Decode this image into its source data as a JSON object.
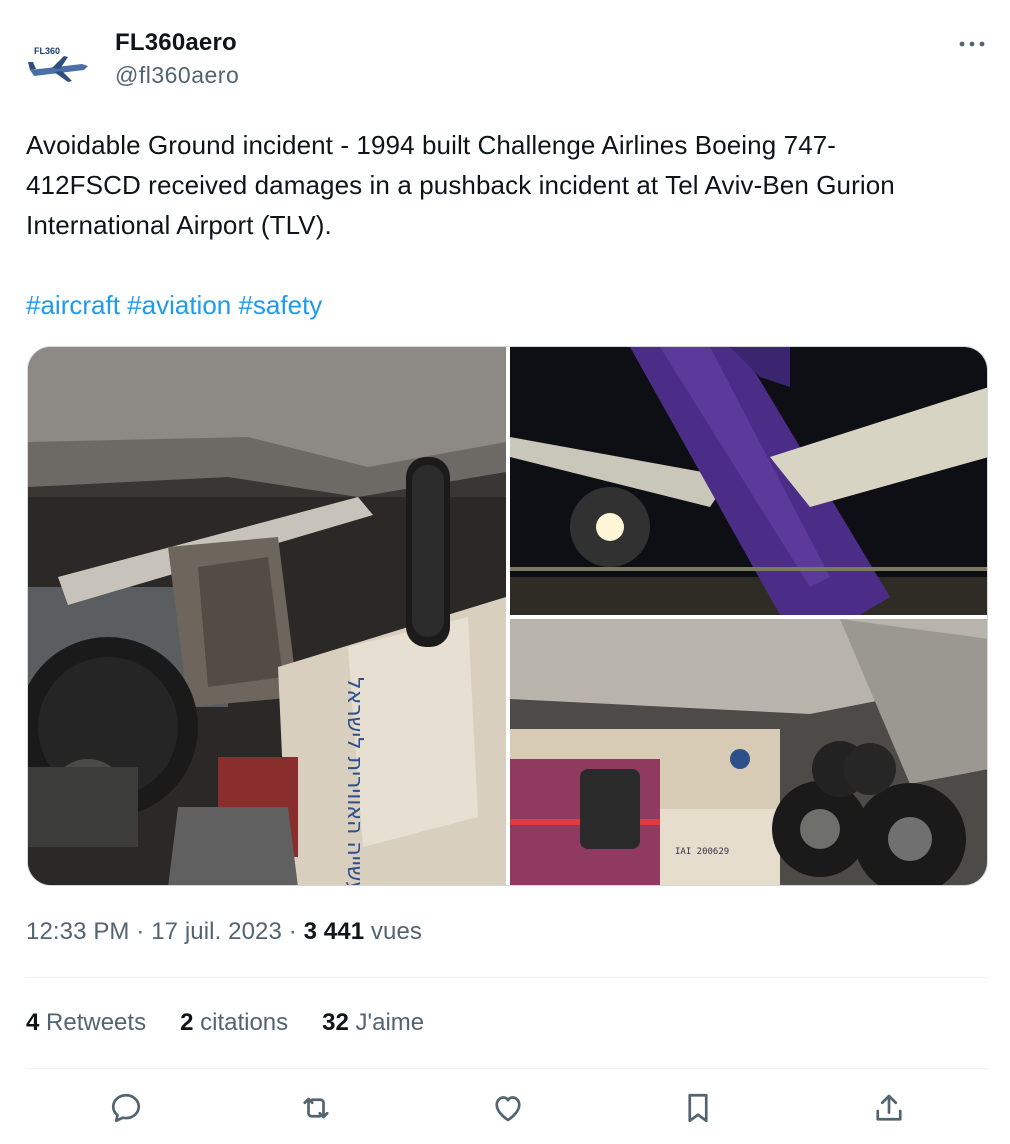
{
  "author": {
    "display_name": "FL360aero",
    "handle": "@fl360aero",
    "avatar_text": "FL360"
  },
  "tweet": {
    "text": "Avoidable Ground incident - 1994 built Challenge Airlines Boeing 747-\n412FSCD received damages in a pushback incident at Tel Aviv-Ben Gurion\nInternational Airport (TLV).",
    "hashtags": [
      "#aircraft",
      "#aviation",
      "#safety"
    ]
  },
  "media": {
    "photos": [
      {
        "name": "pushback tug under damaged wing",
        "tug_sign_text": "התעשייה האווירית לישראל"
      },
      {
        "name": "purple 747 tail at night"
      },
      {
        "name": "tug cabin under wing",
        "tug_plate_text": "IAI 200629"
      }
    ]
  },
  "meta": {
    "time": "12:33 PM",
    "separator": "·",
    "date": "17 juil. 2023",
    "views_count": "3 441",
    "views_label": "vues"
  },
  "stats": {
    "retweets_count": "4",
    "retweets_label": "Retweets",
    "quotes_count": "2",
    "quotes_label": "citations",
    "likes_count": "32",
    "likes_label": "J'aime"
  },
  "icons": {
    "more": "more-icon",
    "reply": "reply-icon",
    "retweet": "retweet-icon",
    "like": "heart-icon",
    "bookmark": "bookmark-icon",
    "share": "share-icon"
  },
  "colors": {
    "hashtag": "#1d9bf0",
    "secondary_text": "#536471",
    "primary_text": "#0f1419",
    "divider": "#eff3f4"
  }
}
